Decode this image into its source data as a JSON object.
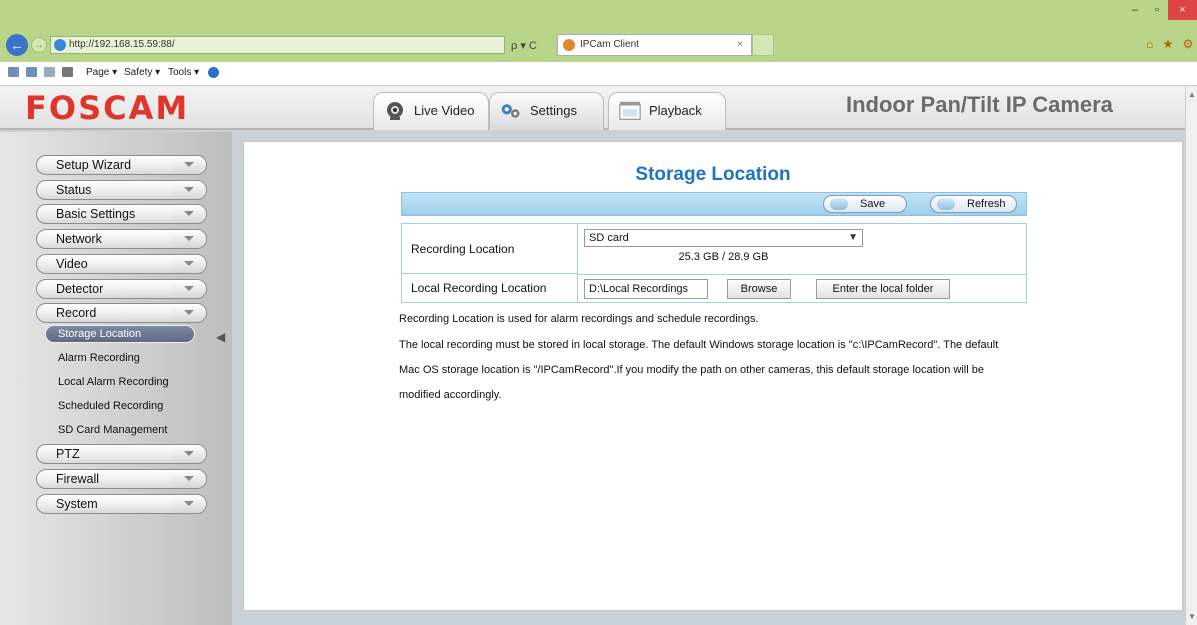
{
  "browser": {
    "url": "http://192.168.15.59:88/",
    "tab_title": "IPCam Client",
    "tab_close": "×",
    "search_refresh": "ρ ▾ C",
    "window_controls": {
      "minimize": "–",
      "maximize": "▫",
      "close": "×"
    },
    "right_icons": "⌂ ★ ⚙",
    "command_bar": {
      "page": "Page ▾",
      "safety": "Safety ▾",
      "tools": "Tools ▾",
      "misc": "▾  ▾  ▾"
    }
  },
  "header": {
    "logo": "FOSCAM",
    "product_title": "Indoor Pan/Tilt IP Camera",
    "tabs": [
      {
        "label": "Live Video",
        "icon": "webcam-icon"
      },
      {
        "label": "Settings",
        "icon": "gears-icon"
      },
      {
        "label": "Playback",
        "icon": "film-icon"
      }
    ]
  },
  "sidebar": {
    "menu": [
      {
        "label": "Setup Wizard"
      },
      {
        "label": "Status"
      },
      {
        "label": "Basic Settings"
      },
      {
        "label": "Network"
      },
      {
        "label": "Video"
      },
      {
        "label": "Detector"
      },
      {
        "label": "Record"
      }
    ],
    "record_submenu": [
      {
        "label": "Storage Location",
        "active": true
      },
      {
        "label": "Alarm Recording"
      },
      {
        "label": "Local Alarm Recording"
      },
      {
        "label": "Scheduled Recording"
      },
      {
        "label": "SD Card Management"
      }
    ],
    "menu_after": [
      {
        "label": "PTZ"
      },
      {
        "label": "Firewall"
      },
      {
        "label": "System"
      }
    ]
  },
  "main": {
    "title": "Storage Location",
    "toolbar": {
      "save": "Save",
      "refresh": "Refresh"
    },
    "recording_location": {
      "label": "Recording Location",
      "selected": "SD card",
      "capacity": "25.3 GB / 28.9 GB"
    },
    "local_recording_location": {
      "label": "Local Recording Location",
      "value": "D:\\Local Recordings",
      "browse": "Browse",
      "enter_folder": "Enter the local folder"
    },
    "help": [
      "Recording Location is used for alarm recordings and schedule recordings.",
      "The local recording must be stored in local storage. The default Windows storage location is \"c:\\IPCamRecord\". The default",
      "Mac OS storage location is \"/IPCamRecord\".If you modify the path on other cameras, this default storage location will be",
      "modified accordingly."
    ]
  },
  "colors": {
    "browser_chrome": "#b9d58a",
    "logo_red": "#e0352b",
    "title_blue": "#1f74c2",
    "toolbar_blue": "#a9d6f0",
    "active_submenu": "#66748c"
  }
}
